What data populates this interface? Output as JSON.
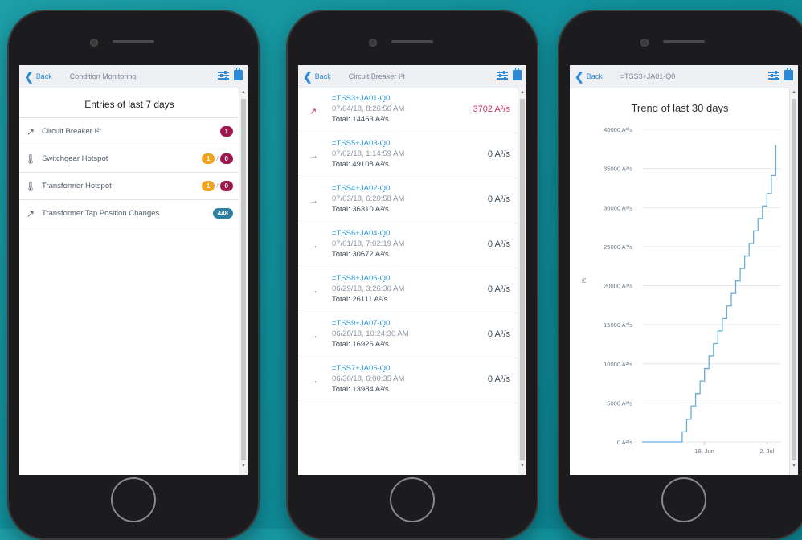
{
  "phones": [
    {
      "nav": {
        "back": "Back",
        "title": "Condition Monitoring"
      },
      "heading": "Entries of last 7 days",
      "items": [
        {
          "label": "Circuit Breaker I²t",
          "icon": "trend-up-icon",
          "badges": [
            {
              "text": "1",
              "color": "red"
            }
          ]
        },
        {
          "label": "Switchgear Hotspot",
          "icon": "thermometer-icon",
          "badges": [
            {
              "text": "1",
              "color": "orange"
            },
            {
              "text": "0",
              "color": "red"
            }
          ],
          "sep": "/"
        },
        {
          "label": "Transformer Hotspot",
          "icon": "thermometer-icon",
          "badges": [
            {
              "text": "1",
              "color": "orange"
            },
            {
              "text": "0",
              "color": "red"
            }
          ],
          "sep": "/"
        },
        {
          "label": "Transformer Tap Position Changes",
          "icon": "trend-up-icon",
          "badges": [
            {
              "text": "448",
              "color": "blue"
            }
          ]
        }
      ]
    },
    {
      "nav": {
        "back": "Back",
        "title": "Circuit Breaker I²t"
      },
      "entries": [
        {
          "name": "=TSS3+JA01-Q0",
          "date": "07/04/18, 8:26:56 AM",
          "total": "Total: 14463 A²/s",
          "value": "3702 A²/s",
          "trend": "up"
        },
        {
          "name": "=TSS5+JA03-Q0",
          "date": "07/02/18, 1:14:59 AM",
          "total": "Total: 49108 A²/s",
          "value": "0 A²/s",
          "trend": "flat"
        },
        {
          "name": "=TSS4+JA02-Q0",
          "date": "07/03/18, 6:20:58 AM",
          "total": "Total: 36310 A²/s",
          "value": "0 A²/s",
          "trend": "flat"
        },
        {
          "name": "=TSS6+JA04-Q0",
          "date": "07/01/18, 7:02:19 AM",
          "total": "Total: 30672 A²/s",
          "value": "0 A²/s",
          "trend": "flat"
        },
        {
          "name": "=TSS8+JA06-Q0",
          "date": "06/29/18, 3:26:30 AM",
          "total": "Total: 26111 A²/s",
          "value": "0 A²/s",
          "trend": "flat"
        },
        {
          "name": "=TSS9+JA07-Q0",
          "date": "06/28/18, 10:24:30 AM",
          "total": "Total: 16926 A²/s",
          "value": "0 A²/s",
          "trend": "flat"
        },
        {
          "name": "=TSS7+JA05-Q0",
          "date": "06/30/18, 6:00:35 AM",
          "total": "Total: 13984 A²/s",
          "value": "0 A²/s",
          "trend": "flat"
        }
      ]
    },
    {
      "nav": {
        "back": "Back",
        "title": "=TSS3+JA01-Q0"
      }
    }
  ],
  "colors": {
    "accent": "#2d8ad6",
    "hot": "#c8336a",
    "badge_red": "#a0174e",
    "badge_orange": "#f2a11b",
    "badge_blue": "#2d7fa0",
    "line": "#6aaed6"
  },
  "chart_data": {
    "type": "line",
    "title": "Trend of last 30 days",
    "ylabel": "I²t",
    "xlabel": "",
    "x_ticks": [
      "18. Jun",
      "2. Jul"
    ],
    "y_ticks": [
      "0 A²/s",
      "5000 A²/s",
      "10000 A²/s",
      "15000 A²/s",
      "20000 A²/s",
      "25000 A²/s",
      "30000 A²/s",
      "35000 A²/s",
      "40000 A²/s"
    ],
    "ylim": [
      0,
      40000
    ],
    "grid": true,
    "series": [
      {
        "x": [
          "2018-06-04",
          "2018-06-12",
          "2018-06-13",
          "2018-06-14",
          "2018-06-15",
          "2018-06-16",
          "2018-06-17",
          "2018-06-18",
          "2018-06-19",
          "2018-06-20",
          "2018-06-21",
          "2018-06-22",
          "2018-06-23",
          "2018-06-24",
          "2018-06-25",
          "2018-06-26",
          "2018-06-27",
          "2018-06-28",
          "2018-06-29",
          "2018-06-30",
          "2018-07-01",
          "2018-07-02",
          "2018-07-03",
          "2018-07-04"
        ],
        "values": [
          0,
          0,
          1300,
          2900,
          4600,
          6200,
          7800,
          9400,
          11000,
          12600,
          14200,
          15800,
          17400,
          19000,
          20600,
          22200,
          23800,
          25400,
          27000,
          28600,
          30200,
          31800,
          34100,
          38000
        ]
      }
    ]
  }
}
